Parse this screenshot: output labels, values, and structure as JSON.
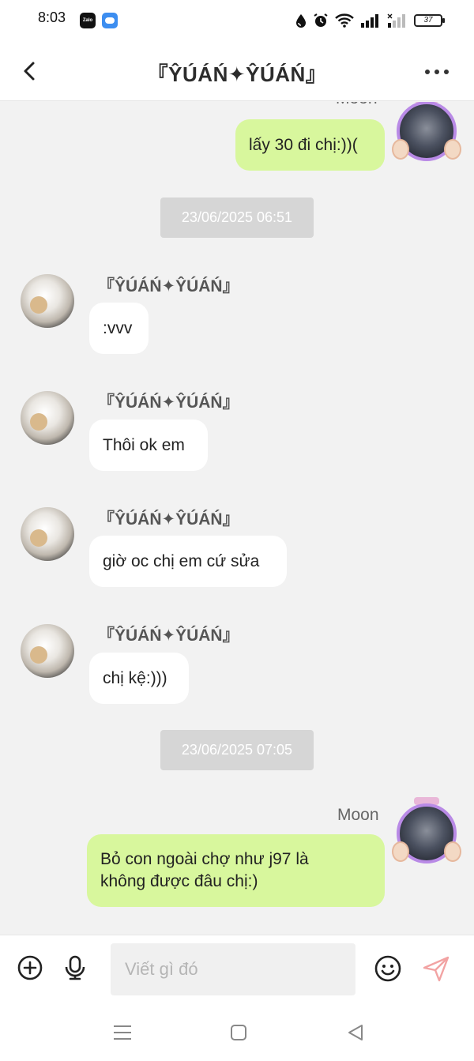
{
  "status_bar": {
    "time": "8:03",
    "zalo_badge": "Zalo",
    "battery": "37"
  },
  "header": {
    "title": "『ŶÚÁŃ✦ŶÚÁŃ』",
    "back_icon": "chevron-left-icon",
    "more_icon": "more-horizontal-icon"
  },
  "messages": {
    "top_partial_name": "Moon",
    "m0": {
      "sender": "Moon",
      "text": "lấy 30 đi chị:))("
    },
    "ts1": "23/06/2025 06:51",
    "m1": {
      "sender": "『ŶÚÁŃ✦ŶÚÁŃ』",
      "text": ":vvv"
    },
    "m2": {
      "sender": "『ŶÚÁŃ✦ŶÚÁŃ』",
      "text": "Thôi ok em"
    },
    "m3": {
      "sender": "『ŶÚÁŃ✦ŶÚÁŃ』",
      "text": "giờ oc chị em cứ sửa"
    },
    "m4": {
      "sender": "『ŶÚÁŃ✦ŶÚÁŃ』",
      "text": "chị kệ:)))"
    },
    "ts2": "23/06/2025 07:05",
    "m5": {
      "sender": "Moon",
      "line1": "Bỏ con ngoài chợ như j97 là",
      "line2": "không được đâu chị:)"
    }
  },
  "input_bar": {
    "placeholder": "Viết gì đó",
    "icons": [
      "plus-circle-icon",
      "microphone-icon",
      "emoji-icon",
      "send-icon"
    ]
  },
  "nav_bar": {
    "icons": [
      "menu-icon",
      "home-square-icon",
      "back-triangle-icon"
    ]
  },
  "colors": {
    "outgoing_bubble": "#d8f79d",
    "incoming_bubble": "#ffffff",
    "chat_background": "#f2f2f2",
    "timestamp_pill": "#d6d6d6"
  }
}
